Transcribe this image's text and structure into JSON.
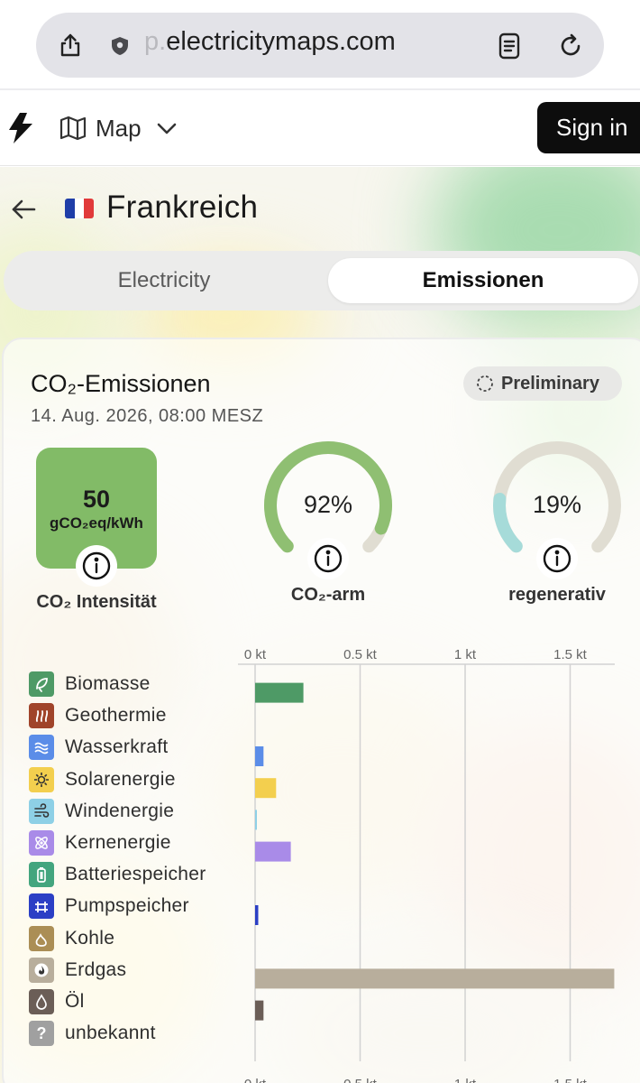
{
  "browser": {
    "url_faded": "p.",
    "url_main": "electricitymaps.com"
  },
  "header": {
    "map_label": "Map",
    "signin_label": "Sign in"
  },
  "zone": {
    "name": "Frankreich"
  },
  "tabs": [
    {
      "label": "Electricity",
      "active": false
    },
    {
      "label": "Emissionen",
      "active": true
    }
  ],
  "card": {
    "title": "CO₂-Emissionen",
    "datetime": "14. Aug. 2026, 08:00 MESZ",
    "badge": "Preliminary",
    "intensity": {
      "value": "50",
      "unit": "gCO₂eq/kWh",
      "label": "CO₂ Intensität",
      "color": "#82bb67"
    },
    "low_carbon": {
      "value_text": "92%",
      "fraction": 0.92,
      "label": "CO₂-arm",
      "color": "#8fbf72"
    },
    "renewable": {
      "value_text": "19%",
      "fraction": 0.19,
      "label": "regenerativ",
      "color": "#a6dbd9"
    }
  },
  "chart_data": {
    "type": "bar",
    "orientation": "horizontal",
    "unit": "kt",
    "tick_labels": [
      "0 kt",
      "0.5 kt",
      "1 kt",
      "1.5 kt"
    ],
    "tick_values": [
      0,
      0.5,
      1,
      1.5
    ],
    "xlim": [
      0,
      1.7
    ],
    "grid": true,
    "categories": [
      "Biomasse",
      "Geothermie",
      "Wasserkraft",
      "Solarenergie",
      "Windenergie",
      "Kernenergie",
      "Batteriespeicher",
      "Pumpspeicher",
      "Kohle",
      "Erdgas",
      "Öl",
      "unbekannt"
    ],
    "values": [
      0.23,
      0,
      0.04,
      0.1,
      0.005,
      0.17,
      0,
      0.015,
      0,
      1.71,
      0.04,
      0
    ],
    "colors": [
      "#4e9a66",
      "#a0442a",
      "#5b8de8",
      "#f3cf4e",
      "#8ed0e6",
      "#a98be8",
      "#43a57e",
      "#2b3fc5",
      "#ab8e55",
      "#b8ae9c",
      "#6b5e57",
      "#a0a0a0"
    ],
    "icons": [
      "leaf-icon",
      "geothermal-icon",
      "water-waves-icon",
      "sun-icon",
      "wind-icon",
      "atom-icon",
      "battery-icon",
      "pumped-storage-icon",
      "coal-icon",
      "gas-flame-icon",
      "oil-drop-icon",
      "question-icon"
    ]
  }
}
